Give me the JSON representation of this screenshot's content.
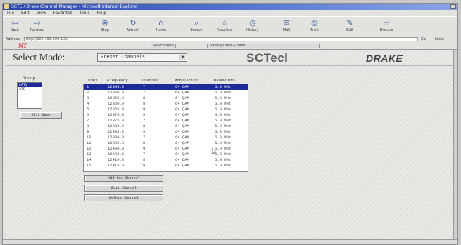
{
  "window": {
    "title": "SCTE / Drake Channel Manager - Microsoft Internet Explorer"
  },
  "menu": [
    "File",
    "Edit",
    "View",
    "Favorites",
    "Tools",
    "Help"
  ],
  "toolbar": [
    "Back",
    "Forward",
    "Stop",
    "Refresh",
    "Home",
    "Search",
    "Favorites",
    "History",
    "Mail",
    "Print",
    "Edit",
    "Discuss"
  ],
  "address": {
    "label": "Address",
    "value": "http://192.168.100.100/",
    "go_label": "Go",
    "links_label": "Links"
  },
  "links_bar": {
    "logo": "NT",
    "button_1": "Search Web",
    "button_2": "Trailing Links & Sites"
  },
  "header": {
    "select_mode_label": "Select Mode:",
    "mode_value": "Preset Channels",
    "brand_center": "SCTeci",
    "brand_right": "DRAKE"
  },
  "group": {
    "label": "Group",
    "items": [
      "CATV",
      "STD"
    ],
    "selected_index": 0,
    "edit_button": "Edit Name"
  },
  "table": {
    "columns": [
      "Index",
      "Frequency",
      "Channel",
      "Modulation",
      "Bandwidth"
    ],
    "rows": [
      [
        "1",
        "12345.0",
        "7",
        "64 QAM",
        "6.0 MHz"
      ],
      [
        "2",
        "12350.0",
        "7",
        "64 QAM",
        "6.0 MHz"
      ],
      [
        "3",
        "12355.0",
        "8",
        "64 QAM",
        "6.0 MHz"
      ],
      [
        "4",
        "12360.0",
        "8",
        "64 QAM",
        "6.0 MHz"
      ],
      [
        "5",
        "12365.0",
        "9",
        "64 QAM",
        "6.0 MHz"
      ],
      [
        "6",
        "12370.0",
        "9",
        "64 QAM",
        "6.0 MHz"
      ],
      [
        "7",
        "12375.0",
        "7",
        "64 QAM",
        "6.0 MHz"
      ],
      [
        "8",
        "12380.0",
        "8",
        "64 QAM",
        "6.0 MHz"
      ],
      [
        "9",
        "12385.0",
        "9",
        "64 QAM",
        "6.0 MHz"
      ],
      [
        "10",
        "12390.0",
        "7",
        "64 QAM",
        "6.0 MHz"
      ],
      [
        "11",
        "12395.0",
        "8",
        "64 QAM",
        "6.0 MHz"
      ],
      [
        "12",
        "12400.0",
        "9",
        "64 QAM",
        "6.0 MHz"
      ],
      [
        "13",
        "12405.0",
        "7",
        "64 QAM",
        "6.0 MHz"
      ],
      [
        "14",
        "12410.0",
        "8",
        "64 QAM",
        "6.0 MHz"
      ],
      [
        "15",
        "12415.0",
        "9",
        "64 QAM",
        "6.0 MHz"
      ]
    ],
    "selected_index": 0
  },
  "actions": {
    "add_button": "Add New Channel",
    "edit_button": "Edit Channel",
    "delete_button": "Delete Channel"
  },
  "colors": {
    "selection": "#1c2a9a",
    "titlebar": "#2846a8",
    "logo_red": "#d2232a"
  }
}
